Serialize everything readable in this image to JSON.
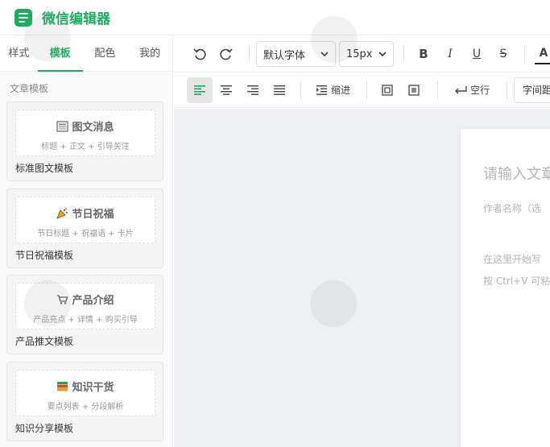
{
  "app": {
    "title": "微信编辑器"
  },
  "sidebar": {
    "tabs": [
      {
        "label": "样式",
        "active": false
      },
      {
        "label": "模板",
        "active": true
      },
      {
        "label": "配色",
        "active": false
      },
      {
        "label": "我的",
        "active": false
      }
    ],
    "section_label": "文章模板",
    "templates": [
      {
        "icon": "newspaper-icon",
        "title": "图文消息",
        "subtitle": "标题 + 正文 + 引导关注",
        "name": "标准图文模板"
      },
      {
        "icon": "party-popper-icon",
        "title": "节日祝福",
        "subtitle": "节日标题 + 祝福语 + 卡片",
        "name": "节日祝福模板"
      },
      {
        "icon": "shopping-cart-icon",
        "title": "产品介绍",
        "subtitle": "产品亮点 + 详情 + 购买引导",
        "name": "产品推文模板"
      },
      {
        "icon": "books-icon",
        "title": "知识干货",
        "subtitle": "要点列表 + 分段解析",
        "name": "知识分享模板"
      }
    ]
  },
  "toolbar": {
    "font_family": "默认字体",
    "font_size": "15px",
    "bold": "B",
    "italic": "I",
    "underline": "U",
    "strike": "S",
    "font_color": "A",
    "indent": "缩进",
    "empty_line": "空行",
    "letter_spacing": "字间距"
  },
  "editor": {
    "title_placeholder": "请输入文章",
    "author_placeholder": "作者名称（选",
    "body_line1": "在这里开始写",
    "body_line2": "按 Ctrl+V 可粘"
  },
  "colors": {
    "accent": "#1aad5c",
    "canvas": "#eef0f3"
  }
}
